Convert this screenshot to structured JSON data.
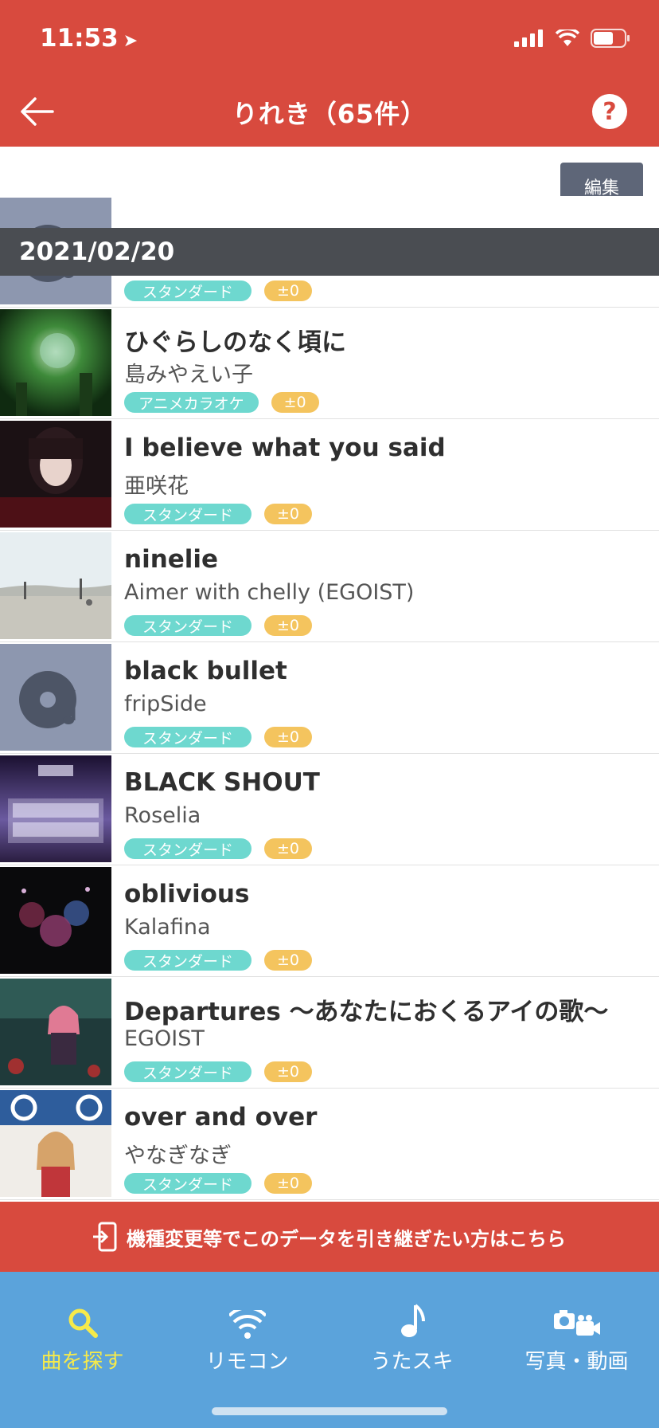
{
  "status": {
    "time": "11:53"
  },
  "nav": {
    "title": "りれき（65件）",
    "help": "?"
  },
  "toolbar": {
    "edit_label": "編集"
  },
  "date_header": "2021/02/20",
  "partial_row": {
    "type": "スタンダード",
    "key": "±0"
  },
  "songs": [
    {
      "title": "ひぐらしのなく頃に",
      "artist": "島みやえい子",
      "type": "アニメカラオケ",
      "key": "±0"
    },
    {
      "title": "I believe what you said",
      "artist": "亜咲花",
      "type": "スタンダード",
      "key": "±0"
    },
    {
      "title": "ninelie",
      "artist": "Aimer with chelly (EGOIST)",
      "type": "スタンダード",
      "key": "±0"
    },
    {
      "title": "black bullet",
      "artist": "fripSide",
      "type": "スタンダード",
      "key": "±0"
    },
    {
      "title": "BLACK SHOUT",
      "artist": "Roselia",
      "type": "スタンダード",
      "key": "±0"
    },
    {
      "title": "oblivious",
      "artist": "Kalafina",
      "type": "スタンダード",
      "key": "±0"
    },
    {
      "title": "Departures 〜あなたにおくるアイの歌〜",
      "artist": "EGOIST",
      "type": "スタンダード",
      "key": "±0"
    },
    {
      "title": "over and over",
      "artist": "やなぎなぎ",
      "type": "スタンダード",
      "key": "±0"
    }
  ],
  "transfer_banner": "機種変更等でこのデータを引き継ぎたい方はこちら",
  "tabs": [
    {
      "label": "曲を探す",
      "icon": "search-icon",
      "active": true
    },
    {
      "label": "リモコン",
      "icon": "wifi-icon",
      "active": false
    },
    {
      "label": "うたスキ",
      "icon": "music-note-icon",
      "active": false
    },
    {
      "label": "写真・動画",
      "icon": "camera-icon",
      "active": false
    }
  ],
  "colors": {
    "accent": "#d84a3e",
    "tab_bar": "#5ba3db",
    "tag_type": "#6ed8cf",
    "tag_key": "#f4c45e",
    "edit_button": "#5e6678",
    "active_tab": "#f6ea4a"
  }
}
